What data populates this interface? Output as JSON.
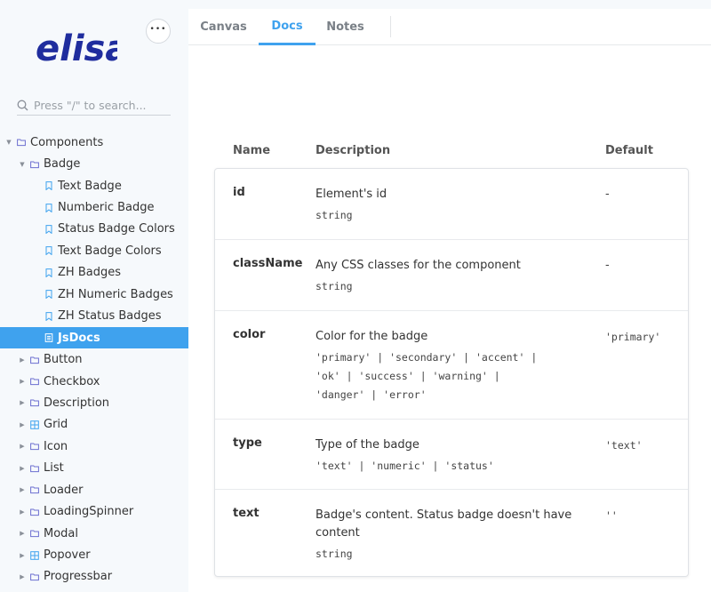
{
  "sidebar": {
    "logo_text": "elisa",
    "more_label": "•••",
    "search_placeholder": "Press \"/\" to search...",
    "tree": [
      {
        "label": "Components",
        "level": 0,
        "kind": "folder",
        "expanded": true
      },
      {
        "label": "Badge",
        "level": 1,
        "kind": "folder",
        "expanded": true
      },
      {
        "label": "Text Badge",
        "level": 2,
        "kind": "story"
      },
      {
        "label": "Numberic Badge",
        "level": 2,
        "kind": "story"
      },
      {
        "label": "Status Badge Colors",
        "level": 2,
        "kind": "story"
      },
      {
        "label": "Text Badge Colors",
        "level": 2,
        "kind": "story"
      },
      {
        "label": "ZH Badges",
        "level": 2,
        "kind": "story"
      },
      {
        "label": "ZH Numeric Badges",
        "level": 2,
        "kind": "story"
      },
      {
        "label": "ZH Status Badges",
        "level": 2,
        "kind": "story"
      },
      {
        "label": "JsDocs",
        "level": 2,
        "kind": "doc",
        "selected": true
      },
      {
        "label": "Button",
        "level": 1,
        "kind": "folder"
      },
      {
        "label": "Checkbox",
        "level": 1,
        "kind": "folder"
      },
      {
        "label": "Description",
        "level": 1,
        "kind": "folder"
      },
      {
        "label": "Grid",
        "level": 1,
        "kind": "component"
      },
      {
        "label": "Icon",
        "level": 1,
        "kind": "folder"
      },
      {
        "label": "List",
        "level": 1,
        "kind": "folder"
      },
      {
        "label": "Loader",
        "level": 1,
        "kind": "folder"
      },
      {
        "label": "LoadingSpinner",
        "level": 1,
        "kind": "folder"
      },
      {
        "label": "Modal",
        "level": 1,
        "kind": "folder"
      },
      {
        "label": "Popover",
        "level": 1,
        "kind": "component"
      },
      {
        "label": "Progressbar",
        "level": 1,
        "kind": "folder"
      }
    ]
  },
  "tabs": [
    {
      "label": "Canvas",
      "active": false
    },
    {
      "label": "Docs",
      "active": true
    },
    {
      "label": "Notes",
      "active": false
    }
  ],
  "table": {
    "headers": {
      "name": "Name",
      "description": "Description",
      "default": "Default"
    },
    "rows": [
      {
        "name": "id",
        "description": "Element's id",
        "type_lines": [
          "string"
        ],
        "default": "-"
      },
      {
        "name": "className",
        "description": "Any CSS classes for the component",
        "type_lines": [
          "string"
        ],
        "default": "-"
      },
      {
        "name": "color",
        "description": "Color for the badge",
        "type_lines": [
          "'primary' | 'secondary' | 'accent' |",
          "'ok' | 'success' | 'warning' |",
          "'danger' | 'error'"
        ],
        "default": "'primary'"
      },
      {
        "name": "type",
        "description": "Type of the badge",
        "type_lines": [
          "'text' | 'numeric' | 'status'"
        ],
        "default": "'text'"
      },
      {
        "name": "text",
        "description": "Badge's content. Status badge doesn't have content",
        "type_lines": [
          "string"
        ],
        "default": "''"
      }
    ]
  },
  "colors": {
    "accent": "#3fa2ee",
    "brand": "#1f2d9e",
    "folder_icon": "#6c6fd0",
    "story_icon": "#3fa2ee",
    "component_icon": "#3fa2ee"
  }
}
